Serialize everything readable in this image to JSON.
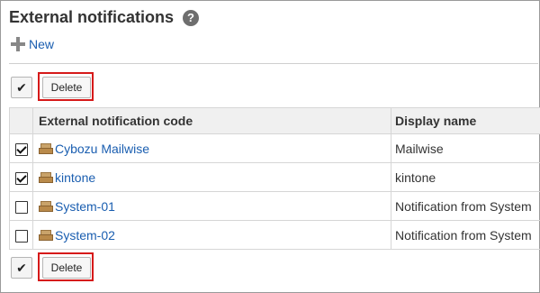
{
  "header": {
    "title": "External notifications",
    "help_icon": "?"
  },
  "toolbar": {
    "new_label": "New",
    "check_all_glyph": "✔",
    "delete_label": "Delete"
  },
  "table": {
    "columns": [
      "External notification code",
      "Display name"
    ],
    "rows": [
      {
        "checked": true,
        "code": "Cybozu Mailwise",
        "display_name": "Mailwise"
      },
      {
        "checked": true,
        "code": "kintone",
        "display_name": "kintone"
      },
      {
        "checked": false,
        "code": "System-01",
        "display_name": "Notification from System"
      },
      {
        "checked": false,
        "code": "System-02",
        "display_name": "Notification from System"
      }
    ]
  },
  "colors": {
    "link": "#1a5eb0",
    "highlight": "#d61a1a"
  }
}
